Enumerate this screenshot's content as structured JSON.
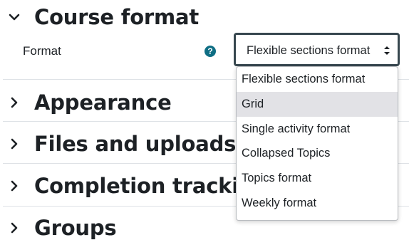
{
  "sections": [
    {
      "title": "Course format",
      "expanded": true
    },
    {
      "title": "Appearance",
      "expanded": false
    },
    {
      "title": "Files and uploads",
      "expanded": false
    },
    {
      "title": "Completion tracking",
      "expanded": false
    },
    {
      "title": "Groups",
      "expanded": false
    }
  ],
  "format_field": {
    "label": "Format",
    "help_symbol": "?",
    "selected_value": "Flexible sections format"
  },
  "dropdown": {
    "options": [
      "Flexible sections format",
      "Grid",
      "Single activity format",
      "Collapsed Topics",
      "Topics format",
      "Weekly format"
    ],
    "highlighted": "Grid"
  },
  "colors": {
    "help_icon": "#0f6e84",
    "select_border": "#37474f",
    "highlight": "#e2e2e6",
    "text": "#1d2125"
  },
  "icons": {
    "expanded": "chevron-down-icon",
    "collapsed": "chevron-right-icon",
    "help": "question-circle-icon",
    "select": "sort-arrows-icon"
  }
}
